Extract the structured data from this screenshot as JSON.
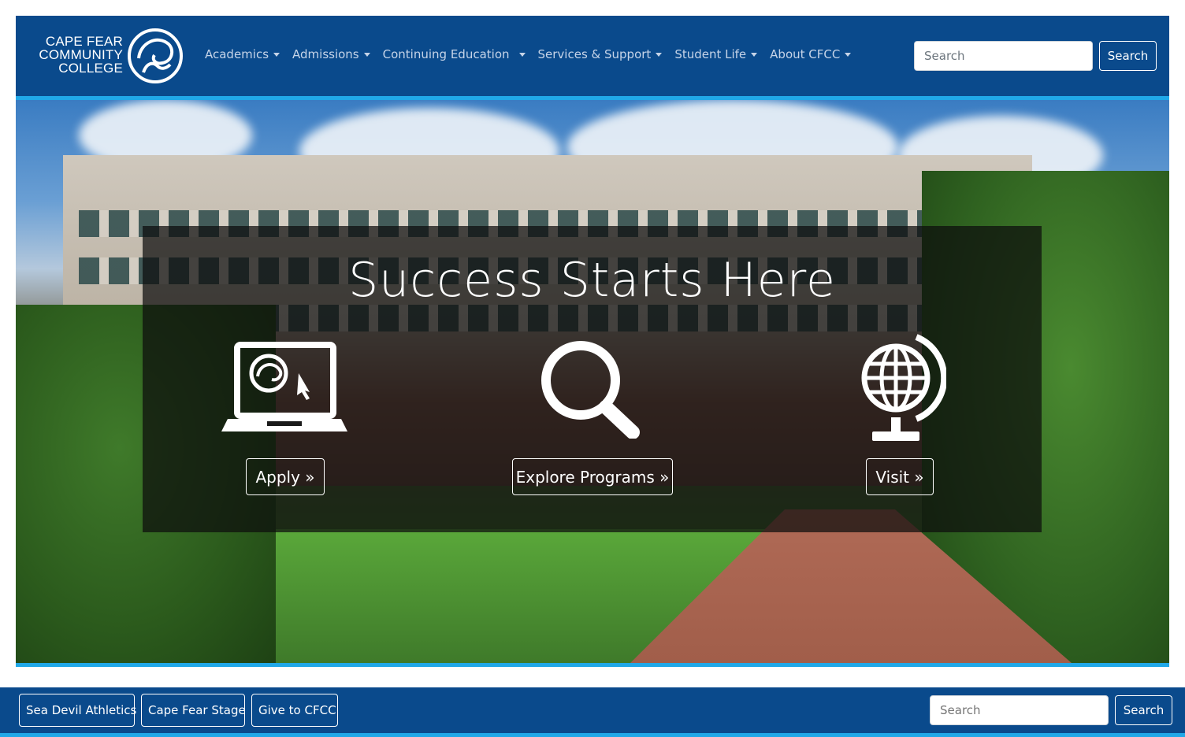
{
  "brand": {
    "logo_lines": [
      "CAPE FEAR",
      "COMMUNITY",
      "COLLEGE"
    ],
    "primary_color": "#0a4a8c",
    "accent_color": "#20a8e8"
  },
  "nav": {
    "items": [
      {
        "label": "Academics",
        "icon": "caret-down-icon"
      },
      {
        "label": "Admissions",
        "icon": "caret-down-icon"
      },
      {
        "label": "Continuing Education",
        "icon": "caret-down-icon"
      },
      {
        "label": "Services & Support",
        "icon": "caret-down-icon"
      },
      {
        "label": "Student Life",
        "icon": "caret-down-icon"
      },
      {
        "label": "About CFCC",
        "icon": "caret-down-icon"
      }
    ]
  },
  "search_top": {
    "placeholder": "Search",
    "button_label": "Search"
  },
  "hero": {
    "title": "Success Starts Here",
    "ctas": [
      {
        "label": "Apply »",
        "icon": "laptop-logo-icon"
      },
      {
        "label": "Explore Programs »",
        "icon": "magnifier-icon"
      },
      {
        "label": "Visit »",
        "icon": "globe-icon"
      }
    ]
  },
  "footer": {
    "links": [
      {
        "label": "Sea Devil Athletics"
      },
      {
        "label": "Cape Fear Stage"
      },
      {
        "label": "Give to CFCC"
      }
    ],
    "search": {
      "placeholder": "Search",
      "button_label": "Search"
    }
  }
}
